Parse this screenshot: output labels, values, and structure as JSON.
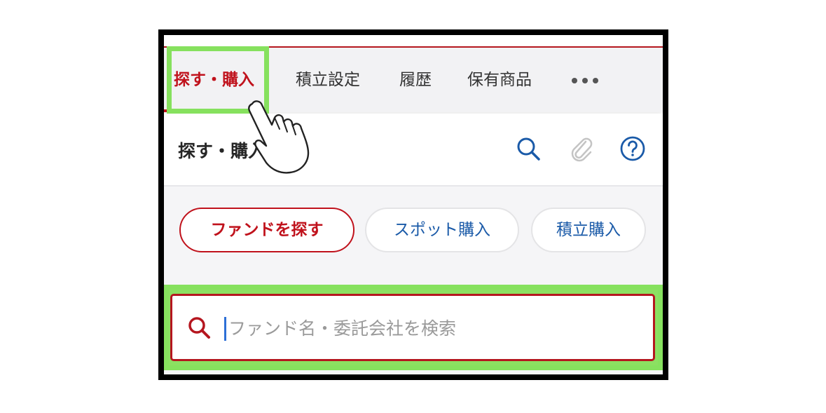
{
  "tabs": [
    {
      "label": "探す・購入",
      "active": true
    },
    {
      "label": "積立設定",
      "active": false
    },
    {
      "label": "履歴",
      "active": false
    },
    {
      "label": "保有商品",
      "active": false
    }
  ],
  "more_icon": "more-horizontal-icon",
  "header": {
    "title": "探す・購入",
    "icons": [
      "search-icon",
      "paperclip-icon",
      "help-icon"
    ]
  },
  "actions": {
    "find_fund": "ファンドを探す",
    "spot_purchase": "スポット購入",
    "recurring_purchase": "積立購入"
  },
  "search": {
    "placeholder": "ファンド名・委託会社を検索",
    "value": ""
  },
  "colors": {
    "accent_red": "#c0121c",
    "link_blue": "#1a5aa8",
    "highlight_green": "#86e15e"
  }
}
